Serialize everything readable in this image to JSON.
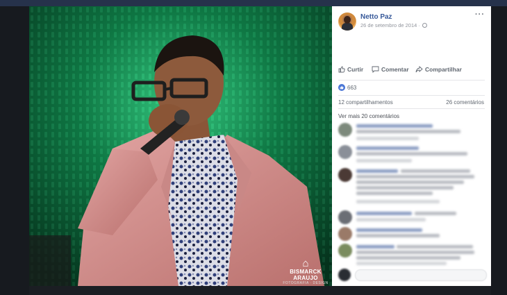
{
  "post": {
    "author": "Netto Paz",
    "date": "26 de setembro de 2014 ·",
    "more_icon": "more-icon",
    "actions": {
      "like": "Curtir",
      "comment": "Comentar",
      "share": "Compartilhar"
    },
    "likes_count": "663",
    "shares": "12 compartilhamentos",
    "comments_count": "26 comentários",
    "view_more": "Ver mais 20 comentários"
  },
  "photo": {
    "watermark_name": "BISMARCK ARAUJO",
    "watermark_sub": "FOTOGRAFIA · DESIGN"
  },
  "colors": {
    "link_blue": "#365899",
    "like_blue": "#4a76d6",
    "stage_green": "#0f7a45"
  }
}
